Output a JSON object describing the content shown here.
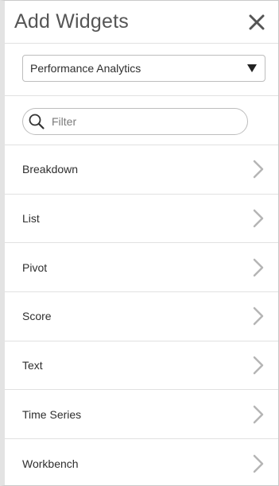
{
  "header": {
    "title": "Add Widgets",
    "close_icon": "close-icon"
  },
  "category_select": {
    "selected": "Performance Analytics",
    "caret_icon": "caret-down-icon"
  },
  "filter": {
    "placeholder": "Filter",
    "value": "",
    "icon": "search-icon"
  },
  "widgets": {
    "items": [
      {
        "label": "Breakdown"
      },
      {
        "label": "List"
      },
      {
        "label": "Pivot"
      },
      {
        "label": "Score"
      },
      {
        "label": "Text"
      },
      {
        "label": "Time Series"
      },
      {
        "label": "Workbench"
      }
    ],
    "chevron_icon": "chevron-right-icon"
  },
  "colors": {
    "title": "#555555",
    "text": "#2e2e2e",
    "divider": "#e1e1e1",
    "chevron": "#b5b5b5",
    "border": "#bdbdbd"
  }
}
